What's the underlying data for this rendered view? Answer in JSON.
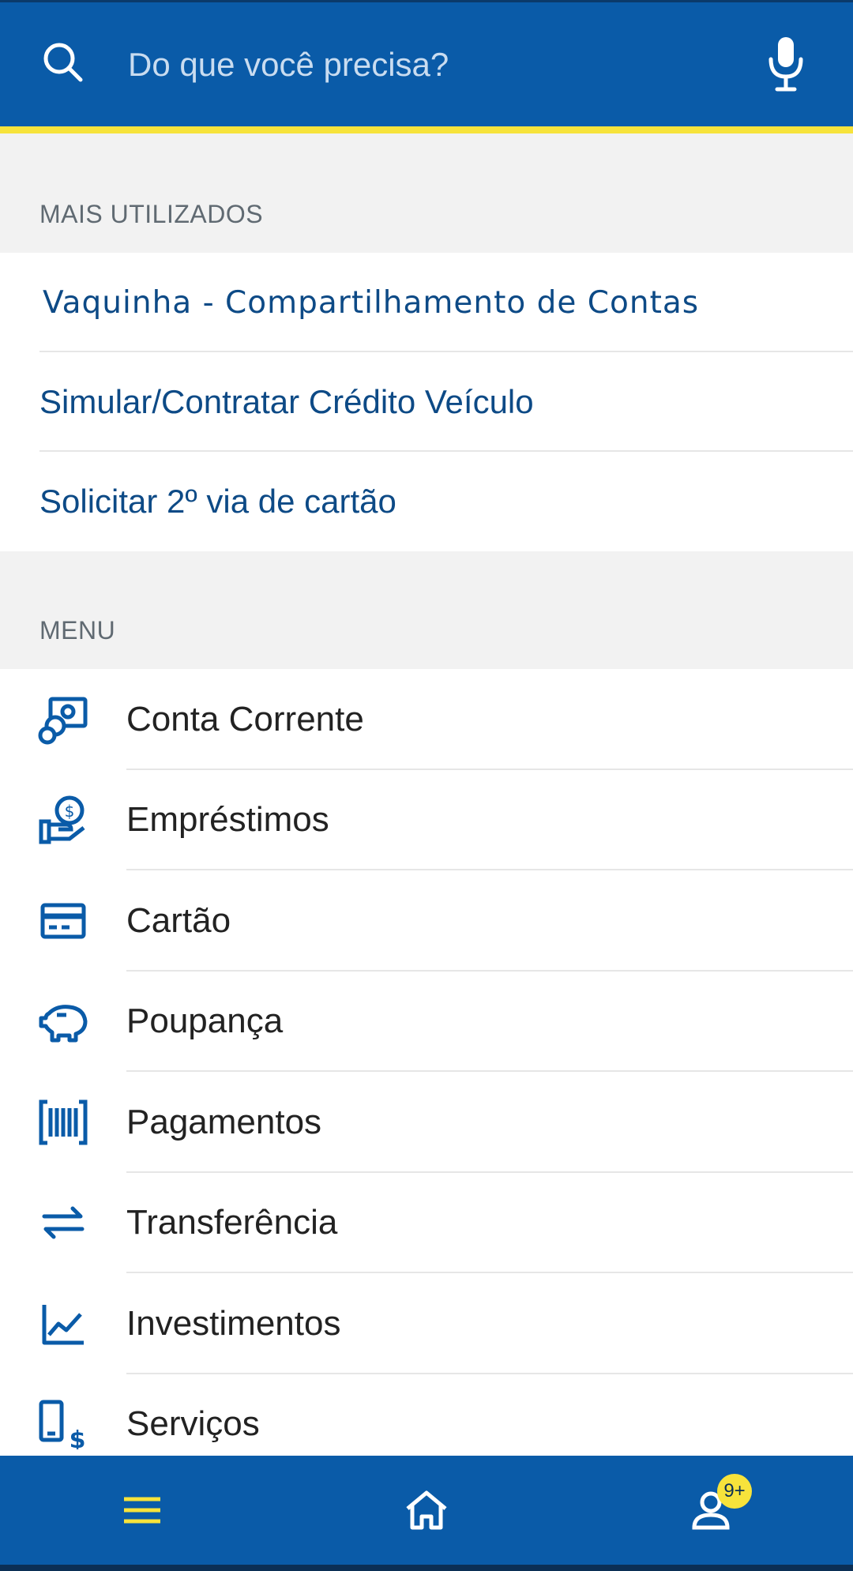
{
  "search": {
    "placeholder": "Do que você precisa?"
  },
  "most_used": {
    "title": "MAIS UTILIZADOS",
    "items": [
      {
        "label": "Vaquinha - Compartilhamento de Contas"
      },
      {
        "label": "Simular/Contratar Crédito Veículo"
      },
      {
        "label": "Solicitar 2º via de cartão"
      }
    ]
  },
  "menu": {
    "title": "MENU",
    "items": [
      {
        "label": "Conta Corrente",
        "icon": "checking-account-icon"
      },
      {
        "label": "Empréstimos",
        "icon": "loan-icon"
      },
      {
        "label": "Cartão",
        "icon": "card-icon"
      },
      {
        "label": "Poupança",
        "icon": "piggy-bank-icon"
      },
      {
        "label": "Pagamentos",
        "icon": "barcode-icon"
      },
      {
        "label": "Transferência",
        "icon": "transfer-icon"
      },
      {
        "label": "Investimentos",
        "icon": "chart-icon"
      },
      {
        "label": "Serviços",
        "icon": "phone-money-icon"
      }
    ]
  },
  "bottom_nav": {
    "items": [
      {
        "icon": "menu-icon"
      },
      {
        "icon": "home-icon"
      },
      {
        "icon": "user-icon"
      }
    ],
    "badge": "9+"
  },
  "colors": {
    "brand_blue": "#0a5ba8",
    "accent_yellow": "#f7e33b",
    "link_blue": "#0d4a86"
  }
}
